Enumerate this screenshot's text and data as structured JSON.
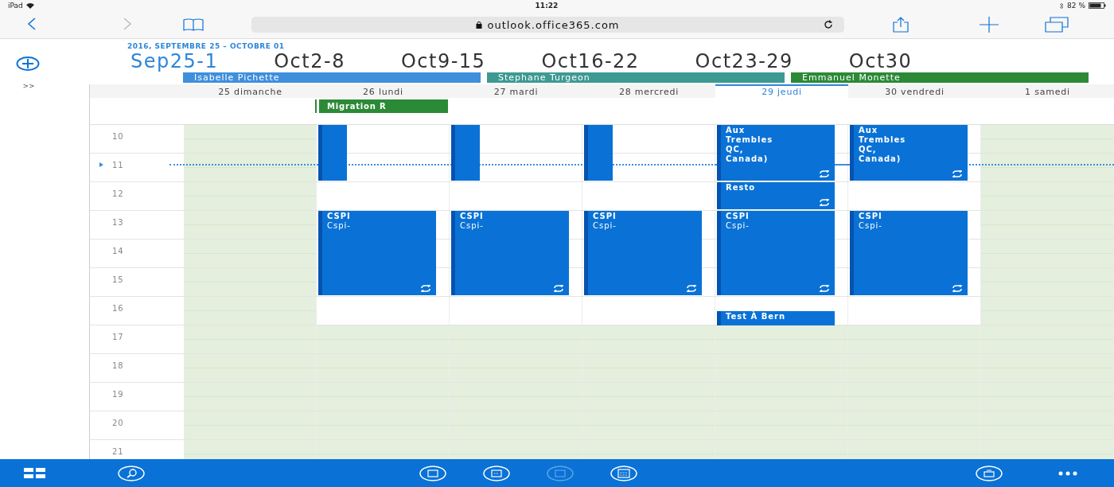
{
  "status_bar": {
    "device": "iPad",
    "time": "11:22",
    "battery": "82 %"
  },
  "browser": {
    "url": "outlook.office365.com",
    "back_enabled": true,
    "forward_enabled": false
  },
  "sidebar": {
    "expand": ">>"
  },
  "calendar": {
    "range": "2016, SEPTEMBRE 25 – OCTOBRE 01",
    "weeks": [
      {
        "label": "Sep25-1",
        "selected": true
      },
      {
        "label": "Oct2-8",
        "selected": false
      },
      {
        "label": "Oct9-15",
        "selected": false
      },
      {
        "label": "Oct16-22",
        "selected": false
      },
      {
        "label": "Oct23-29",
        "selected": false
      },
      {
        "label": "Oct30",
        "selected": false
      }
    ],
    "calendars": [
      {
        "name": "Isabelle Pichette",
        "color": "#3f8fdc"
      },
      {
        "name": "Stephane Turgeon",
        "color": "#3d9a93"
      },
      {
        "name": "Emmanuel Monette",
        "color": "#2b8a36"
      }
    ],
    "days": [
      {
        "label": "25 dimanche",
        "selected": false,
        "weekend": true
      },
      {
        "label": "26 lundi",
        "selected": false,
        "weekend": false,
        "all_day": [
          {
            "title": "Migration R"
          }
        ],
        "events": [
          {
            "kind": "sliver",
            "recurring": false
          },
          {
            "kind": "afternoon",
            "title": "CSPI",
            "subtitle": "Cspi-",
            "recurring": true
          }
        ]
      },
      {
        "label": "27 mardi",
        "selected": false,
        "weekend": false,
        "events": [
          {
            "kind": "sliver",
            "recurring": false
          },
          {
            "kind": "afternoon",
            "title": "CSPI",
            "subtitle": "Cspi-",
            "recurring": true
          }
        ]
      },
      {
        "label": "28 mercredi",
        "selected": false,
        "weekend": false,
        "events": [
          {
            "kind": "sliver",
            "recurring": false
          },
          {
            "kind": "afternoon",
            "title": "CSPI",
            "subtitle": "Cspi-",
            "recurring": true
          }
        ]
      },
      {
        "label": "29 jeudi",
        "selected": true,
        "weekend": false,
        "events": [
          {
            "kind": "morning",
            "title": "Aux Trembles QC, Canada)",
            "recurring": true
          },
          {
            "kind": "lunch",
            "title": "Resto",
            "recurring": true
          },
          {
            "kind": "afternoon",
            "title": "CSPI",
            "subtitle": "Cspi-",
            "recurring": true
          },
          {
            "kind": "late",
            "title": "Test À Bern",
            "recurring": false
          }
        ]
      },
      {
        "label": "30 vendredi",
        "selected": false,
        "weekend": false,
        "events": [
          {
            "kind": "morning",
            "title": "Aux Trembles QC, Canada)",
            "recurring": true
          },
          {
            "kind": "afternoon",
            "title": "CSPI",
            "subtitle": "Cspi-",
            "recurring": true
          }
        ]
      },
      {
        "label": "1 samedi",
        "selected": false,
        "weekend": true
      }
    ],
    "hours": [
      {
        "label": "10",
        "working": true
      },
      {
        "label": "11",
        "working": true
      },
      {
        "label": "12",
        "working": true
      },
      {
        "label": "13",
        "working": true
      },
      {
        "label": "14",
        "working": true
      },
      {
        "label": "15",
        "working": true
      },
      {
        "label": "16",
        "working": true
      },
      {
        "label": "17",
        "working": false
      },
      {
        "label": "18",
        "working": false
      },
      {
        "label": "19",
        "working": false
      },
      {
        "label": "20",
        "working": false
      },
      {
        "label": "21",
        "working": false
      }
    ]
  },
  "bottom_bar": {
    "views": [
      {
        "disabled": false
      },
      {
        "disabled": false
      },
      {
        "disabled": true
      },
      {
        "disabled": false
      }
    ]
  }
}
